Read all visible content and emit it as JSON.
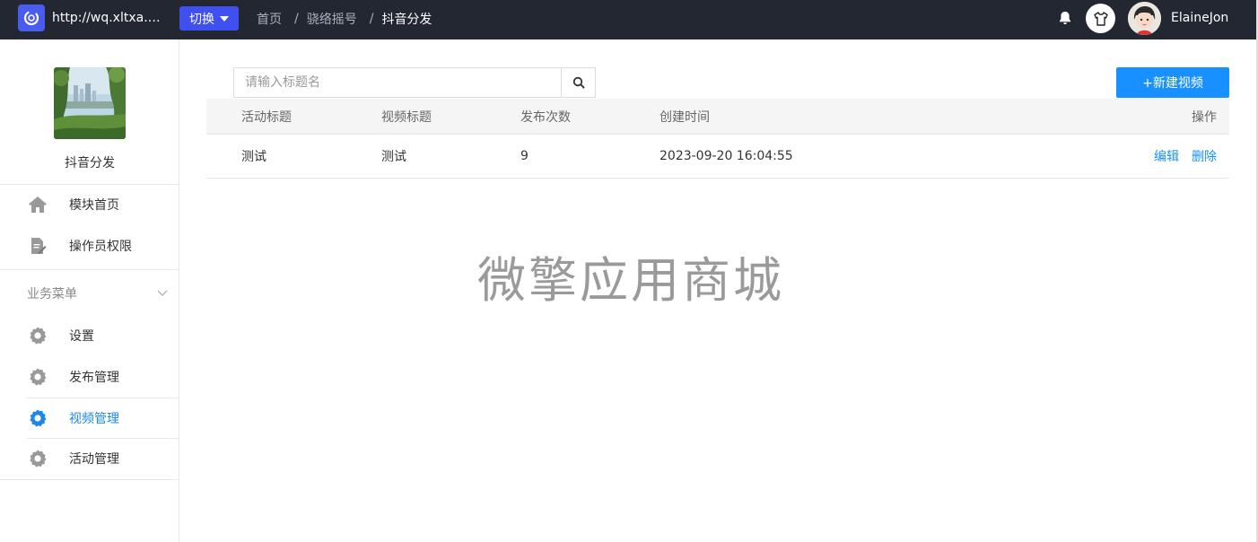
{
  "header": {
    "site_url": "http://wq.xltxa.…",
    "switch_label": "切换",
    "breadcrumb": [
      "首页",
      "骁络摇号",
      "抖音分发"
    ],
    "breadcrumb_sep": "/",
    "username": "ElaineJon"
  },
  "sidebar": {
    "module_name": "抖音分发",
    "top_items": [
      {
        "label": "模块首页",
        "icon": "home-icon"
      },
      {
        "label": "操作员权限",
        "icon": "document-edit-icon"
      }
    ],
    "group_title": "业务菜单",
    "group_items": [
      {
        "label": "设置",
        "icon": "gear-icon"
      },
      {
        "label": "发布管理",
        "icon": "gear-icon"
      },
      {
        "label": "视频管理",
        "icon": "gear-icon",
        "active": true
      },
      {
        "label": "活动管理",
        "icon": "gear-icon"
      }
    ]
  },
  "main": {
    "search_placeholder": "请输入标题名",
    "new_button": "+新建视频",
    "table": {
      "columns": [
        "活动标题",
        "视频标题",
        "发布次数",
        "创建时间",
        "操作"
      ],
      "rows": [
        {
          "activity_title": "测试",
          "video_title": "测试",
          "publish_count": "9",
          "created_at": "2023-09-20 16:04:55",
          "actions": [
            "编辑",
            "删除"
          ]
        }
      ]
    },
    "watermark": "微擎应用商城"
  },
  "colors": {
    "topbar": "#222732",
    "switch": "#4050f0",
    "primary": "#1890ff",
    "active_menu": "#1e88e5"
  }
}
